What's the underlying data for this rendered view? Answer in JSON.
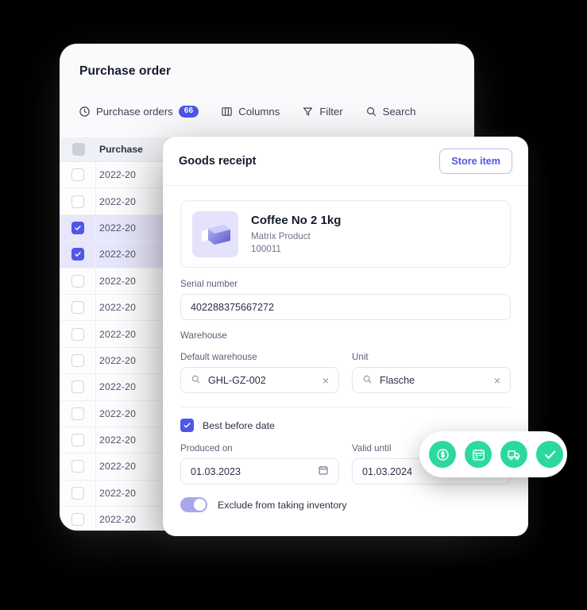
{
  "purchase_order": {
    "title": "Purchase order",
    "toolbar": [
      {
        "label": "Purchase orders",
        "icon": "clock-icon",
        "badge": "66"
      },
      {
        "label": "Columns",
        "icon": "columns-icon",
        "badge": ""
      },
      {
        "label": "Filter",
        "icon": "filter-icon",
        "badge": ""
      },
      {
        "label": "Search",
        "icon": "search-icon",
        "badge": ""
      }
    ],
    "table": {
      "header": "Purchase",
      "rows": [
        {
          "value": "2022-20",
          "selected": false
        },
        {
          "value": "2022-20",
          "selected": false
        },
        {
          "value": "2022-20",
          "selected": true
        },
        {
          "value": "2022-20",
          "selected": true
        },
        {
          "value": "2022-20",
          "selected": false
        },
        {
          "value": "2022-20",
          "selected": false
        },
        {
          "value": "2022-20",
          "selected": false
        },
        {
          "value": "2022-20",
          "selected": false
        },
        {
          "value": "2022-20",
          "selected": false
        },
        {
          "value": "2022-20",
          "selected": false
        },
        {
          "value": "2022-20",
          "selected": false
        },
        {
          "value": "2022-20",
          "selected": false
        },
        {
          "value": "2022-20",
          "selected": false
        },
        {
          "value": "2022-20",
          "selected": false
        }
      ]
    }
  },
  "goods_receipt": {
    "title": "Goods receipt",
    "store_item_label": "Store item",
    "product": {
      "name": "Coffee No 2 1kg",
      "type": "Matrix Product",
      "sku": "100011"
    },
    "serial_number": {
      "label": "Serial number",
      "value": "402288375667272"
    },
    "warehouse_section_label": "Warehouse",
    "default_warehouse": {
      "label": "Default warehouse",
      "value": "GHL-GZ-002",
      "clear": "×"
    },
    "unit": {
      "label": "Unit",
      "value": "Flasche",
      "clear": "×"
    },
    "best_before": {
      "label": "Best before date",
      "checked": true
    },
    "produced_on": {
      "label": "Produced on",
      "value": "01.03.2023"
    },
    "valid_until": {
      "label": "Valid until",
      "value": "01.03.2024"
    },
    "exclude_inventory": {
      "label": "Exclude from taking inventory",
      "on": true
    }
  },
  "action_pill": {
    "actions": [
      {
        "name": "dollar-circle-icon"
      },
      {
        "name": "calendar-icon"
      },
      {
        "name": "truck-icon"
      },
      {
        "name": "check-icon"
      }
    ]
  },
  "colors": {
    "accent": "#4f56e8",
    "accent_soft": "#a8a7ec",
    "green": "#2bd9a0",
    "panel": "#fafafc",
    "background": "#000000"
  }
}
